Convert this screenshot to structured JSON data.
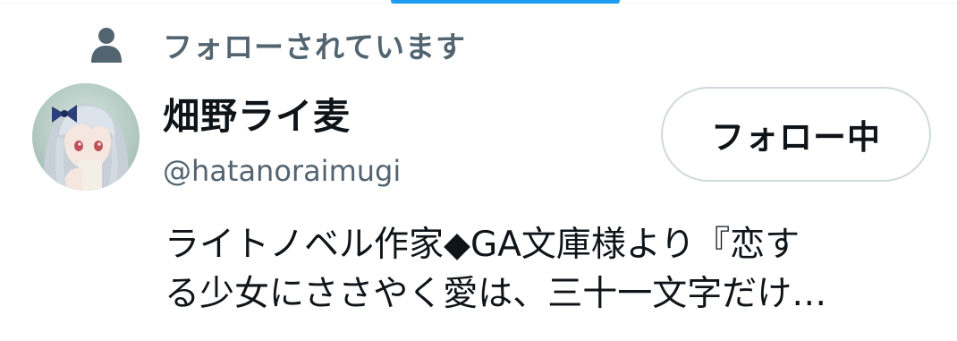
{
  "context": {
    "icon": "person-icon",
    "label": "フォローされています"
  },
  "user": {
    "display_name": "畑野ライ麦",
    "handle": "@hatanoraimugi",
    "avatar": "anime-girl-avatar"
  },
  "follow_button": {
    "label": "フォロー中"
  },
  "bio": {
    "line1": "ライトノベル作家◆GA文庫様より『恋す",
    "line2": "る少女にささやく愛は、三十一文字だけ…"
  },
  "colors": {
    "accent": "#1d9bf0",
    "text_primary": "#0f1419",
    "text_secondary": "#536471",
    "border": "#cfd9de"
  }
}
